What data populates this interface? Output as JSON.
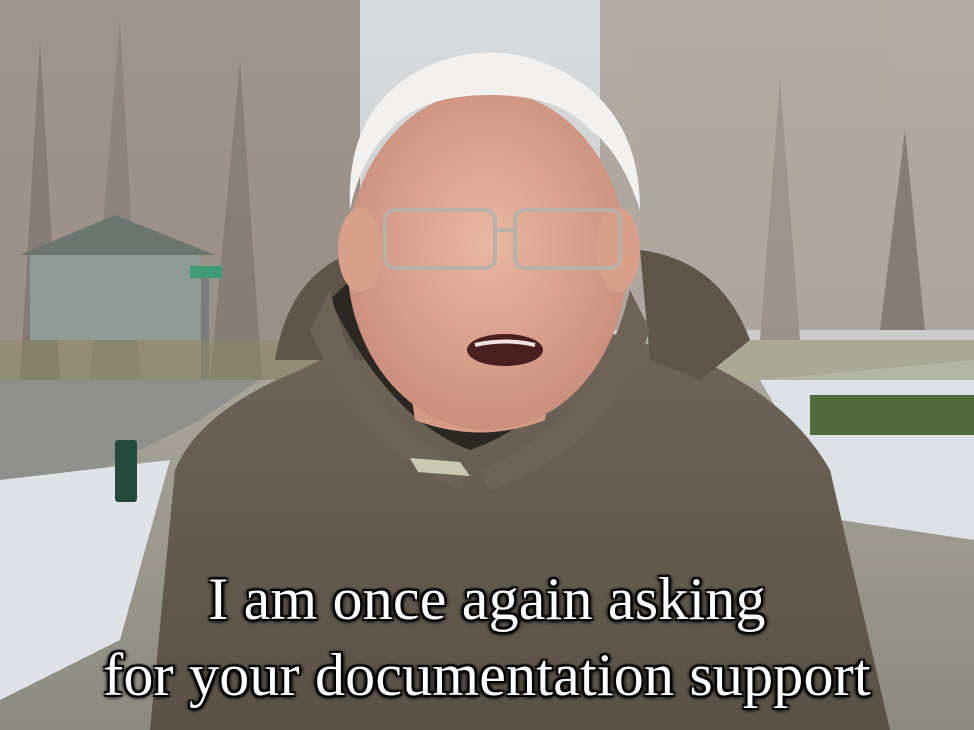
{
  "caption": {
    "line1": "I am once again asking",
    "line2": "for your documentation support"
  }
}
